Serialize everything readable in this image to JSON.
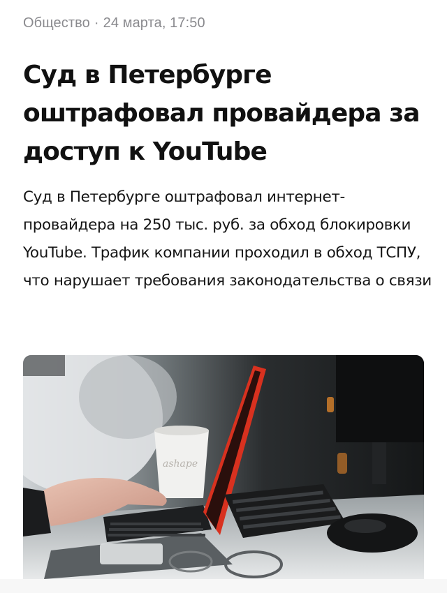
{
  "article": {
    "category": "Общество",
    "separator": "·",
    "date": "24 марта, 17:50",
    "headline": "Суд в Петербурге оштрафовал провайдера за доступ к YouTube",
    "lead": "Суд в Петербурге оштрафовал интернет-провайдера на 250 тыс. руб. за обход блокировки YouTube. Трафик компании проходил в обход ТСПУ, что нарушает требования законодательства о связи",
    "image": {
      "subject": "person-typing-on-laptop-in-office",
      "cup_text": "ashape"
    }
  }
}
